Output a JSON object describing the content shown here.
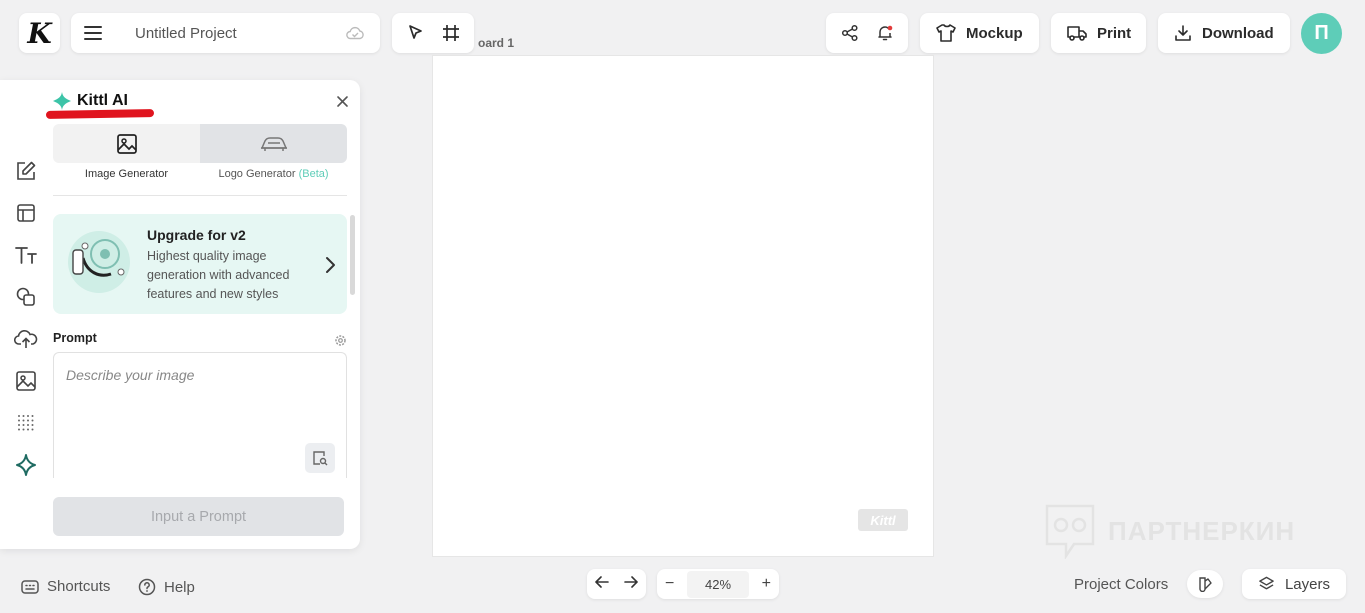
{
  "header": {
    "logo": "K",
    "project_title": "Untitled Project",
    "actions": {
      "mockup": "Mockup",
      "print": "Print",
      "download": "Download"
    },
    "avatar_initial": "П"
  },
  "canvas": {
    "artboard_label": "oard 1",
    "watermark": "Kittl"
  },
  "panel": {
    "title": "Kittl AI",
    "tabs": [
      {
        "label": "Image Generator",
        "active": true
      },
      {
        "label": "Logo Generator",
        "badge": "(Beta)",
        "active": false
      }
    ],
    "upgrade": {
      "title": "Upgrade for v2",
      "description": "Highest quality image generation with advanced features and new styles"
    },
    "prompt": {
      "label": "Prompt",
      "placeholder": "Describe your image",
      "value": ""
    },
    "generate_button": "Input a Prompt"
  },
  "sidebar_icons": [
    "edit-icon",
    "templates-icon",
    "text-icon",
    "shapes-icon",
    "upload-icon",
    "photos-icon",
    "pattern-icon",
    "ai-sparkle-icon"
  ],
  "footer": {
    "shortcuts": "Shortcuts",
    "help": "Help",
    "zoom": "42%",
    "project_colors": "Project Colors",
    "layers": "Layers"
  },
  "watermark_overlay": "ПАРТНЕРКИН",
  "colors": {
    "accent": "#5ecdb8",
    "annotation_red": "#e0141e"
  }
}
